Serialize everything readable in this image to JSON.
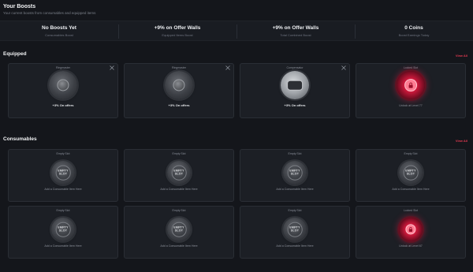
{
  "header": {
    "title": "Your Boosts",
    "subtitle": "Your current boosts from consumables and equipped items"
  },
  "stats": [
    {
      "value": "No Boosts Yet",
      "label": "Consumables Boost"
    },
    {
      "value": "+9% on Offer Walls",
      "label": "Equipped Items Boost"
    },
    {
      "value": "+9% on Offer Walls",
      "label": "Total Combined Boost"
    },
    {
      "value": "0 Coins",
      "label": "Boost Earnings Today"
    }
  ],
  "equipped": {
    "title": "Equipped",
    "view_all": "View All",
    "items": [
      {
        "caption": "Ringmaster",
        "footer": "+3% On offers",
        "icon": "dark-ring-disc-icon"
      },
      {
        "caption": "Ringmaster",
        "footer": "+3% On offers",
        "icon": "dark-ring-disc-icon"
      },
      {
        "caption": "Compensator",
        "footer": "+3% On offers",
        "icon": "silver-device-icon"
      },
      {
        "caption": "Locked Slot",
        "footer": "Unlock at Level 77",
        "icon": "lock-icon"
      }
    ]
  },
  "consumables": {
    "title": "Consumables",
    "view_all": "View All",
    "empty_label_1": "EMPTY",
    "empty_label_2": "SLOT",
    "items": [
      {
        "caption": "Empty Slot",
        "footer": "Add a Consumable Item Here"
      },
      {
        "caption": "Empty Slot",
        "footer": "Add a Consumable Item Here"
      },
      {
        "caption": "Empty Slot",
        "footer": "Add a Consumable Item Here"
      },
      {
        "caption": "Empty Slot",
        "footer": "Add a Consumable Item Here"
      },
      {
        "caption": "Empty Slot",
        "footer": "Add a Consumable Item Here"
      },
      {
        "caption": "Empty Slot",
        "footer": "Add a Consumable Item Here"
      },
      {
        "caption": "Empty Slot",
        "footer": "Add a Consumable Item Here"
      },
      {
        "caption": "Locked Slot",
        "footer": "Unlock at Level 67"
      }
    ]
  },
  "colors": {
    "accent": "#e23950",
    "background": "#14161b",
    "card": "#1c1f25"
  }
}
